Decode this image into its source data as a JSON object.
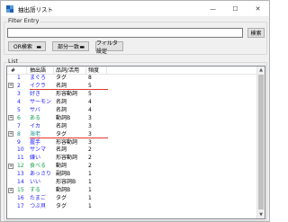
{
  "window": {
    "title": "抽出語リスト",
    "controls": [
      "—",
      "☐",
      "✕"
    ]
  },
  "filter": {
    "group_label": "Filter Entry",
    "input_value": "",
    "search_label": "検索",
    "or_label": "OR検索",
    "partial_label": "部分一致",
    "filterset_label": "フィルタ設定"
  },
  "list": {
    "group_label": "List",
    "columns": [
      "#",
      "抽出語",
      "品詞/活用",
      "頻度"
    ],
    "rows": [
      {
        "exp": "",
        "num": "1",
        "word": "まぐろ",
        "pos": "タグ",
        "freq": "8",
        "style": "blue"
      },
      {
        "exp": "+",
        "num": "2",
        "word": "イクラ",
        "pos": "名詞",
        "freq": "5",
        "style": "blue",
        "underline": true
      },
      {
        "exp": "",
        "num": "3",
        "word": "好き",
        "pos": "形容動詞",
        "freq": "5",
        "style": "blue"
      },
      {
        "exp": "",
        "num": "4",
        "word": "サーモン",
        "pos": "名詞",
        "freq": "4",
        "style": "blue"
      },
      {
        "exp": "",
        "num": "5",
        "word": "サバ",
        "pos": "名詞",
        "freq": "4",
        "style": "blue"
      },
      {
        "exp": "+",
        "num": "6",
        "word": "ある",
        "pos": "動詞B",
        "freq": "3",
        "style": "green"
      },
      {
        "exp": "",
        "num": "7",
        "word": "イカ",
        "pos": "名詞",
        "freq": "3",
        "style": "blue"
      },
      {
        "exp": "+",
        "num": "8",
        "word": "海老",
        "pos": "タグ",
        "freq": "3",
        "style": "teal",
        "underline": true
      },
      {
        "exp": "",
        "num": "9",
        "word": "握手",
        "pos": "形容動詞",
        "freq": "3",
        "style": "blue"
      },
      {
        "exp": "",
        "num": "10",
        "word": "サンマ",
        "pos": "名詞",
        "freq": "2",
        "style": "blue"
      },
      {
        "exp": "",
        "num": "11",
        "word": "嫌い",
        "pos": "形容動詞",
        "freq": "2",
        "style": "blue"
      },
      {
        "exp": "+",
        "num": "12",
        "word": "食べる",
        "pos": "動詞",
        "freq": "2",
        "style": "green"
      },
      {
        "exp": "",
        "num": "13",
        "word": "あっさり",
        "pos": "副詞B",
        "freq": "1",
        "style": "blue"
      },
      {
        "exp": "",
        "num": "14",
        "word": "いい",
        "pos": "形容詞B",
        "freq": "1",
        "style": "blue"
      },
      {
        "exp": "+",
        "num": "15",
        "word": "する",
        "pos": "動詞B",
        "freq": "1",
        "style": "green"
      },
      {
        "exp": "",
        "num": "16",
        "word": "たまご",
        "pos": "タグ",
        "freq": "1",
        "style": "blue"
      },
      {
        "exp": "",
        "num": "17",
        "word": "つぶ貝",
        "pos": "タグ",
        "freq": "1",
        "style": "blue"
      }
    ]
  },
  "colors": {
    "word_blue": "#1c1cff",
    "word_green": "#16a04a",
    "word_teal": "#1a8f8f",
    "annotation_red": "#e0392b"
  }
}
